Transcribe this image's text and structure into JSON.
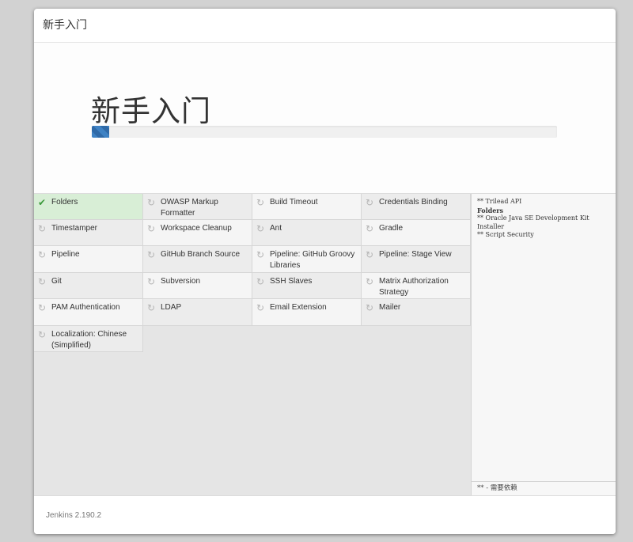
{
  "dialog": {
    "header_title": "新手入门",
    "hero_title": "新手入门",
    "progress_fraction": 0.037
  },
  "plugins": [
    {
      "label": "Folders",
      "status": "done",
      "icon": "check-icon"
    },
    {
      "label": "OWASP Markup Formatter",
      "status": "pending",
      "icon": "spinner-icon"
    },
    {
      "label": "Build Timeout",
      "status": "pending",
      "icon": "spinner-icon"
    },
    {
      "label": "Credentials Binding",
      "status": "pending",
      "icon": "spinner-icon"
    },
    {
      "label": "Timestamper",
      "status": "pending",
      "icon": "spinner-icon"
    },
    {
      "label": "Workspace Cleanup",
      "status": "pending",
      "icon": "spinner-icon"
    },
    {
      "label": "Ant",
      "status": "pending",
      "icon": "spinner-icon"
    },
    {
      "label": "Gradle",
      "status": "pending",
      "icon": "spinner-icon"
    },
    {
      "label": "Pipeline",
      "status": "pending",
      "icon": "spinner-icon"
    },
    {
      "label": "GitHub Branch Source",
      "status": "pending",
      "icon": "spinner-icon"
    },
    {
      "label": "Pipeline: GitHub Groovy Libraries",
      "status": "pending",
      "icon": "spinner-icon"
    },
    {
      "label": "Pipeline: Stage View",
      "status": "pending",
      "icon": "spinner-icon"
    },
    {
      "label": "Git",
      "status": "pending",
      "icon": "spinner-icon"
    },
    {
      "label": "Subversion",
      "status": "pending",
      "icon": "spinner-icon"
    },
    {
      "label": "SSH Slaves",
      "status": "pending",
      "icon": "spinner-icon"
    },
    {
      "label": "Matrix Authorization Strategy",
      "status": "pending",
      "icon": "spinner-icon"
    },
    {
      "label": "PAM Authentication",
      "status": "pending",
      "icon": "spinner-icon"
    },
    {
      "label": "LDAP",
      "status": "pending",
      "icon": "spinner-icon"
    },
    {
      "label": "Email Extension",
      "status": "pending",
      "icon": "spinner-icon"
    },
    {
      "label": "Mailer",
      "status": "pending",
      "icon": "spinner-icon"
    },
    {
      "label": "Localization: Chinese (Simplified)",
      "status": "pending",
      "icon": "spinner-icon"
    }
  ],
  "log": {
    "lines": [
      {
        "text": "** Trilead API",
        "bold": false
      },
      {
        "text": "Folders",
        "bold": true
      },
      {
        "text": "** Oracle Java SE Development Kit Installer",
        "bold": false
      },
      {
        "text": "** Script Security",
        "bold": false
      }
    ],
    "footer": "** - 需要依赖"
  },
  "footer": {
    "version": "Jenkins 2.190.2"
  },
  "colors": {
    "done_tile": "#d8eed6",
    "check": "#3c9a3c",
    "progress": "#3e82c4"
  }
}
